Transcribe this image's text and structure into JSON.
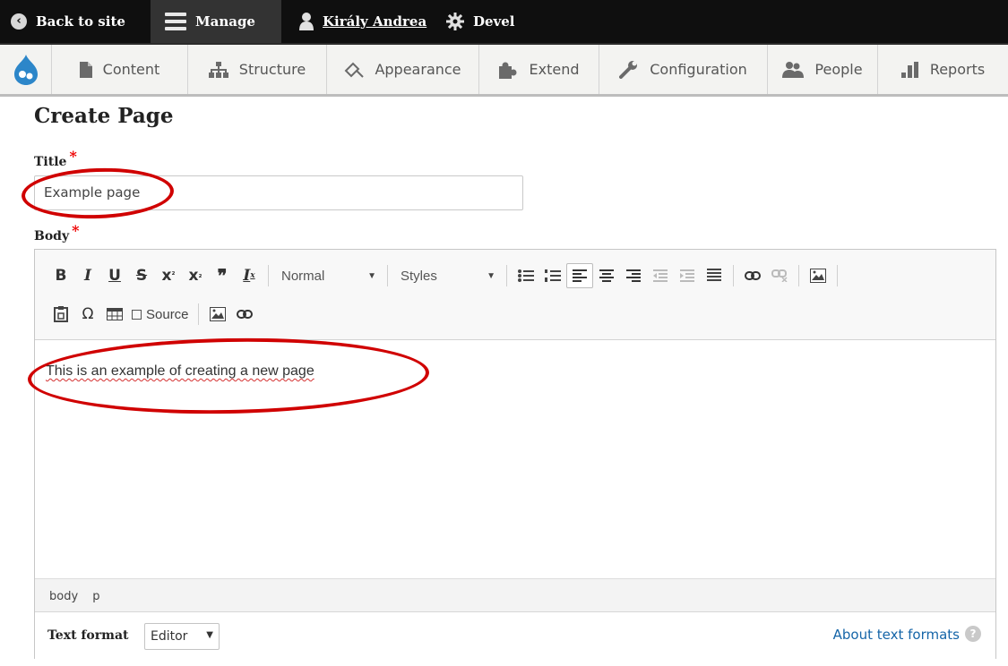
{
  "admin_bar": {
    "back_label": "Back to site",
    "manage_label": "Manage",
    "user_label": "Király Andrea",
    "devel_label": "Devel"
  },
  "tray": {
    "items": [
      {
        "label": "Content",
        "icon": "document-icon"
      },
      {
        "label": "Structure",
        "icon": "sitemap-icon"
      },
      {
        "label": "Appearance",
        "icon": "paint-icon"
      },
      {
        "label": "Extend",
        "icon": "puzzle-icon"
      },
      {
        "label": "Configuration",
        "icon": "wrench-icon"
      },
      {
        "label": "People",
        "icon": "people-icon"
      },
      {
        "label": "Reports",
        "icon": "bar-chart-icon"
      }
    ]
  },
  "form": {
    "heading": "Create Page",
    "title_label": "Title",
    "title_value": "Example page",
    "body_label": "Body",
    "required_mark": "*"
  },
  "editor": {
    "format_combo": "Normal",
    "styles_combo": "Styles",
    "source_label": "Source",
    "content": "This is an example of creating a new page",
    "path": [
      "body",
      "p"
    ],
    "text_format_label": "Text format",
    "text_format_value": "Editor",
    "about_link": "About text formats"
  },
  "colors": {
    "annotation": "#d00000",
    "link": "#1565a8",
    "required": "#ee0000"
  }
}
